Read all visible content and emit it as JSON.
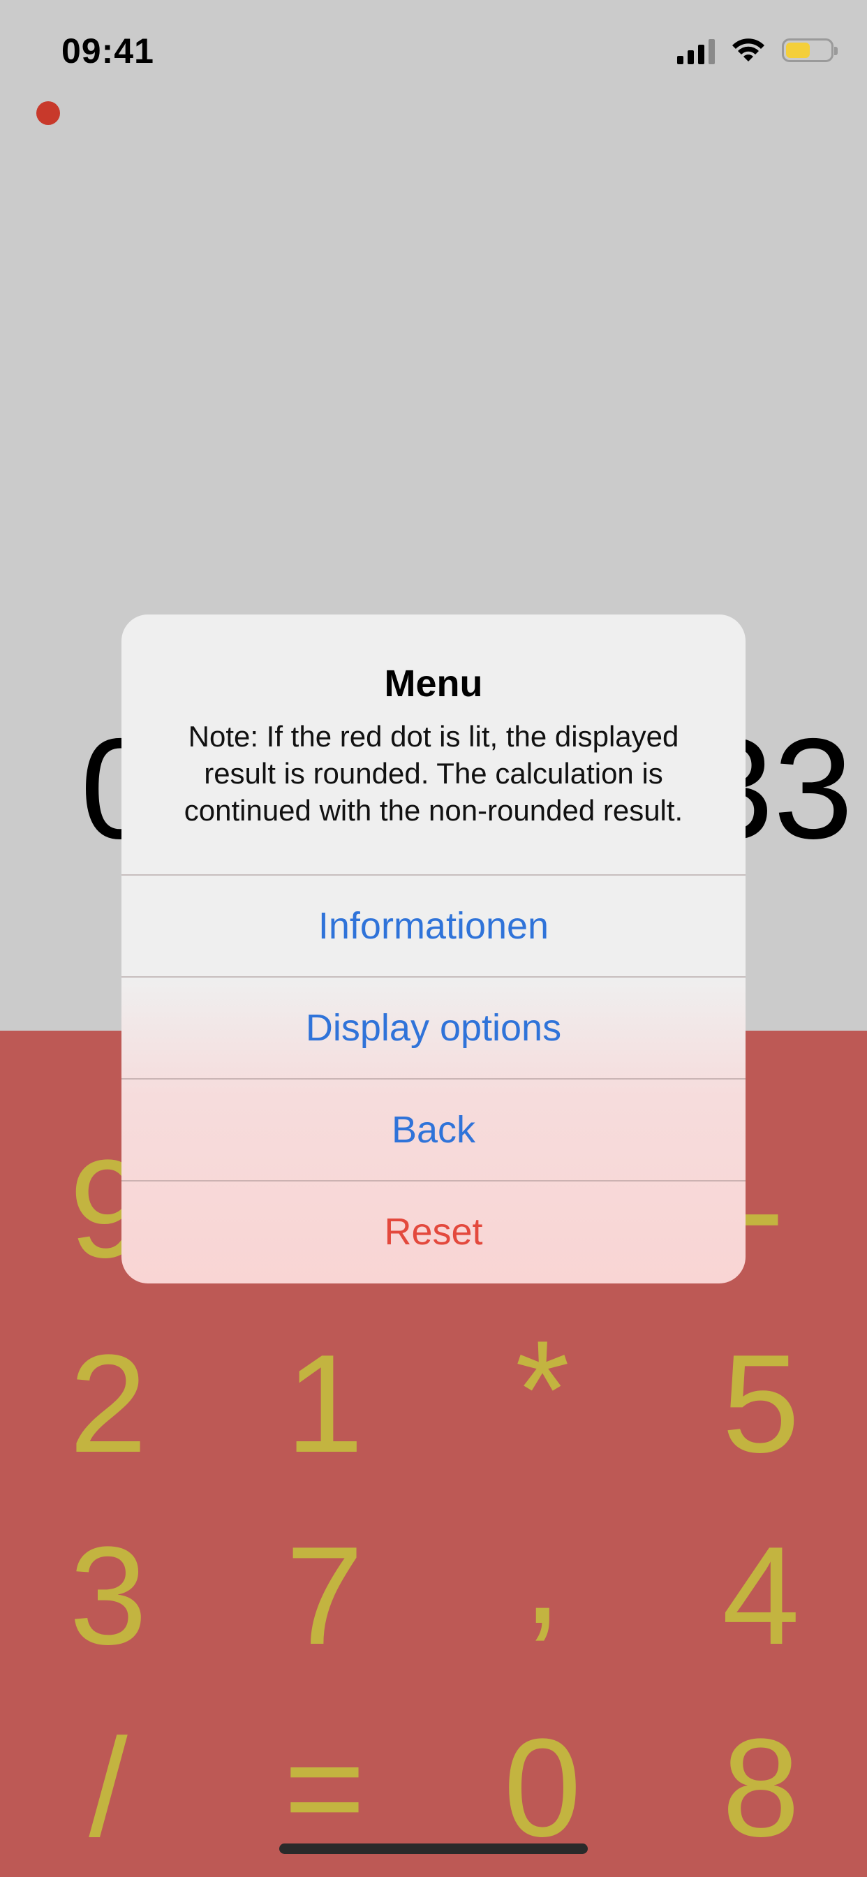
{
  "status_bar": {
    "time": "09:41"
  },
  "display": {
    "left_digits": "0",
    "right_digits": "33"
  },
  "keypad": {
    "rows": [
      [
        "9",
        "-"
      ],
      [
        "2",
        "1",
        "*",
        "5"
      ],
      [
        "3",
        "7",
        ",",
        "4"
      ],
      [
        "/",
        "=",
        "0",
        "8"
      ]
    ]
  },
  "dialog": {
    "title": "Menu",
    "message": "Note: If the red dot is lit, the displayed result is rounded. The calculation is continued with the non-rounded result.",
    "buttons": {
      "info": "Informationen",
      "display_options": "Display options",
      "back": "Back",
      "reset": "Reset"
    }
  },
  "colors": {
    "background": "#cbcbcb",
    "keypad_background": "#bd5955",
    "key_text": "#c3b440",
    "rounding_dot": "#c8392b",
    "action_blue": "#2f73d9",
    "destructive_red": "#e3493d",
    "battery": "#f4cf3a"
  },
  "icons": [
    "cellular-signal-icon",
    "wifi-icon",
    "battery-icon",
    "rounding-indicator-dot"
  ],
  "battery_level_fraction": 0.55
}
